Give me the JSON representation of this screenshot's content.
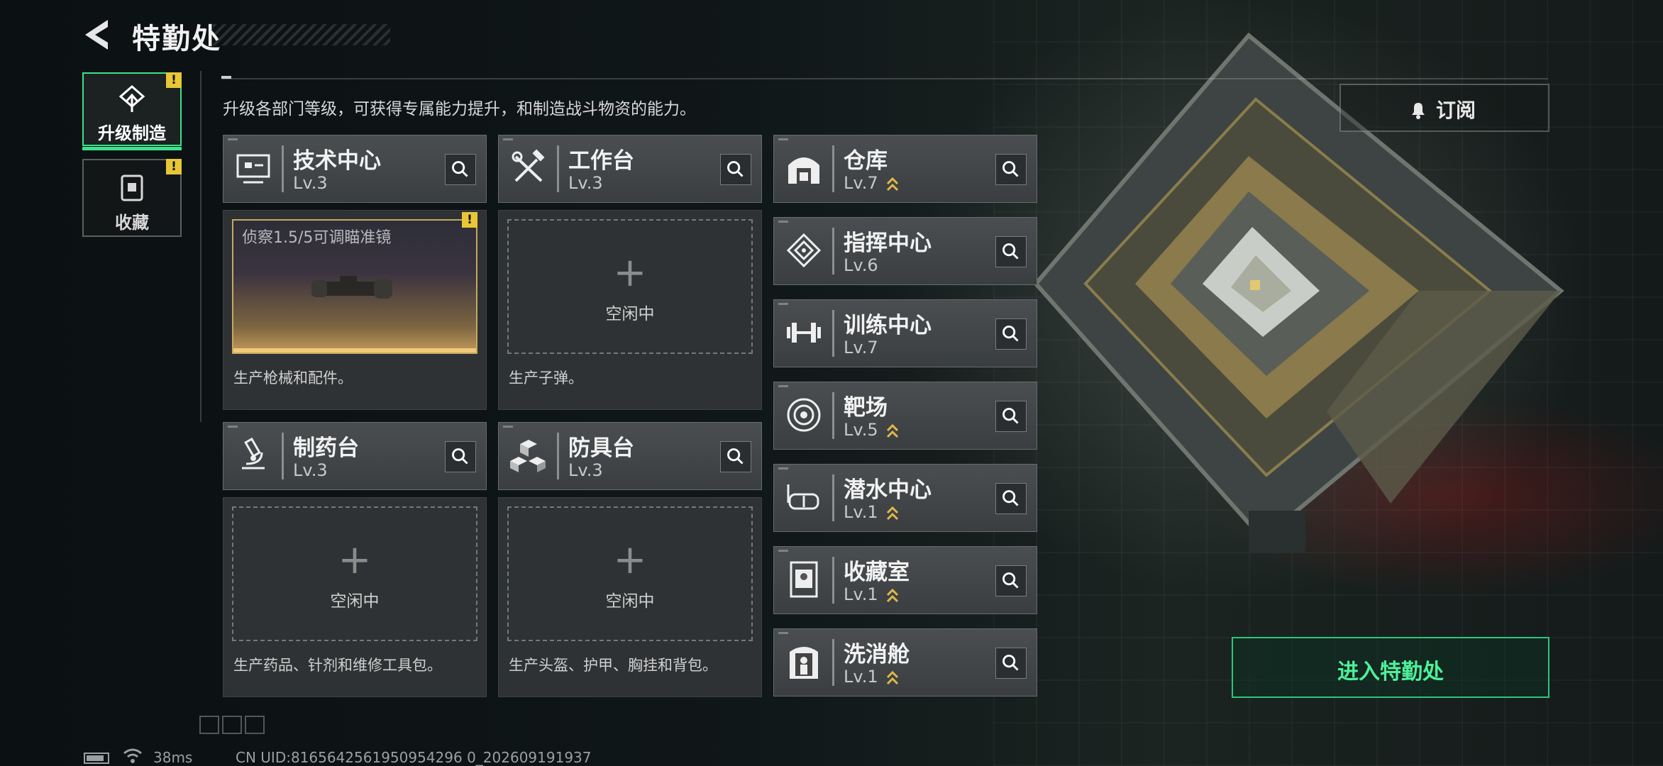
{
  "header": {
    "title": "特勤处",
    "description": "升级各部门等级，可获得专属能力提升，和制造战斗物资的能力。"
  },
  "tabs": [
    {
      "label": "升级制造",
      "alert": "!",
      "active": true,
      "icon": "upgrade-icon"
    },
    {
      "label": "收藏",
      "alert": "!",
      "active": false,
      "icon": "collection-icon"
    }
  ],
  "departments_main": [
    {
      "name": "技术中心",
      "level": "Lv.3",
      "icon": "monitor-icon"
    },
    {
      "name": "工作台",
      "level": "Lv.3",
      "icon": "tools-icon"
    },
    {
      "name": "制药台",
      "level": "Lv.3",
      "icon": "microscope-icon"
    },
    {
      "name": "防具台",
      "level": "Lv.3",
      "icon": "cubes-icon"
    }
  ],
  "slots": [
    {
      "filled": true,
      "item_name": "侦察1.5/5可调瞄准镜",
      "alert": "!",
      "desc": "生产枪械和配件。"
    },
    {
      "filled": false,
      "plus": "+",
      "idle": "空闲中",
      "desc": "生产子弹。"
    },
    {
      "filled": false,
      "plus": "+",
      "idle": "空闲中",
      "desc": "生产药品、针剂和维修工具包。"
    },
    {
      "filled": false,
      "plus": "+",
      "idle": "空闲中",
      "desc": "生产头盔、护甲、胸挂和背包。"
    }
  ],
  "departments_side": [
    {
      "name": "仓库",
      "level": "Lv.7",
      "upgradable": true,
      "icon": "warehouse-icon"
    },
    {
      "name": "指挥中心",
      "level": "Lv.6",
      "upgradable": false,
      "icon": "chip-icon"
    },
    {
      "name": "训练中心",
      "level": "Lv.7",
      "upgradable": false,
      "icon": "dumbbell-icon"
    },
    {
      "name": "靶场",
      "level": "Lv.5",
      "upgradable": true,
      "icon": "target-icon"
    },
    {
      "name": "潜水中心",
      "level": "Lv.1",
      "upgradable": true,
      "icon": "diving-mask-icon"
    },
    {
      "name": "收藏室",
      "level": "Lv.1",
      "upgradable": true,
      "icon": "display-case-icon"
    },
    {
      "name": "洗消舱",
      "level": "Lv.1",
      "upgradable": true,
      "icon": "decon-pod-icon"
    }
  ],
  "buttons": {
    "subscribe": "订阅",
    "enter": "进入特勤处"
  },
  "footer": {
    "ping": "38ms",
    "uid": "CN UID:8165642561950954296 0_202609191937"
  },
  "colors": {
    "accent_green": "#3ce38c",
    "alert_yellow": "#e8c636",
    "upgrade_gold": "#e0b84a"
  }
}
